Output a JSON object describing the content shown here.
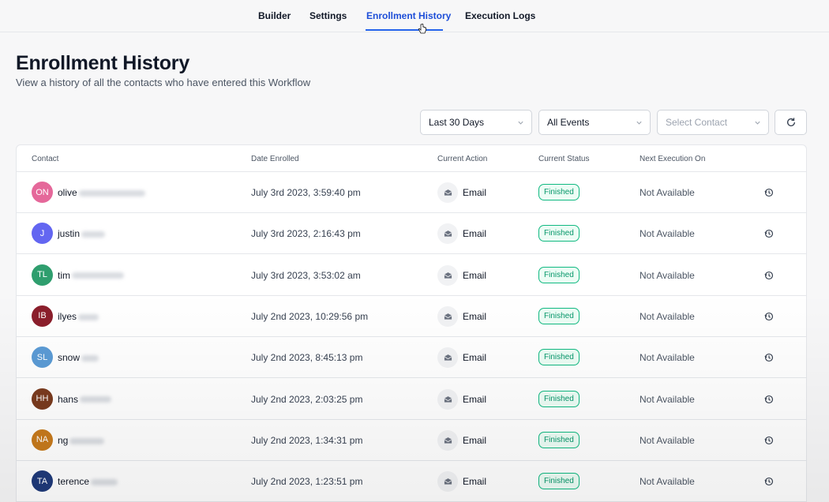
{
  "nav": {
    "tabs": [
      {
        "label": "Builder"
      },
      {
        "label": "Settings"
      },
      {
        "label": "Enrollment History",
        "active": true
      },
      {
        "label": "Execution Logs"
      }
    ]
  },
  "page": {
    "title": "Enrollment History",
    "subtitle": "View a history of all the contacts who have entered this Workflow"
  },
  "filters": {
    "date_range": "Last 30 Days",
    "events": "All Events",
    "contact_placeholder": "Select Contact",
    "refresh_icon": "refresh-icon"
  },
  "table": {
    "columns": [
      "Contact",
      "Date Enrolled",
      "Current Action",
      "Current Status",
      "Next Execution On"
    ],
    "rows": [
      {
        "initials": "ON",
        "avatar_color": "#e5689a",
        "name": "olive",
        "date": "July 3rd 2023, 3:59:40 pm",
        "action": "Email",
        "status": "Finished",
        "next": "Not Available"
      },
      {
        "initials": "J",
        "avatar_color": "#6366f1",
        "name": "justin",
        "date": "July 3rd 2023, 2:16:43 pm",
        "action": "Email",
        "status": "Finished",
        "next": "Not Available"
      },
      {
        "initials": "TL",
        "avatar_color": "#2f9e6e",
        "name": "tim",
        "date": "July 3rd 2023, 3:53:02 am",
        "action": "Email",
        "status": "Finished",
        "next": "Not Available"
      },
      {
        "initials": "IB",
        "avatar_color": "#8b1e2b",
        "name": "ilyes",
        "date": "July 2nd 2023, 10:29:56 pm",
        "action": "Email",
        "status": "Finished",
        "next": "Not Available"
      },
      {
        "initials": "SL",
        "avatar_color": "#5b9bd5",
        "name": "snow",
        "date": "July 2nd 2023, 8:45:13 pm",
        "action": "Email",
        "status": "Finished",
        "next": "Not Available"
      },
      {
        "initials": "HH",
        "avatar_color": "#7a3b1e",
        "name": "hans",
        "date": "July 2nd 2023, 2:03:25 pm",
        "action": "Email",
        "status": "Finished",
        "next": "Not Available"
      },
      {
        "initials": "NA",
        "avatar_color": "#c77a1c",
        "name": "ng",
        "date": "July 2nd 2023, 1:34:31 pm",
        "action": "Email",
        "status": "Finished",
        "next": "Not Available"
      },
      {
        "initials": "TA",
        "avatar_color": "#1f3a7a",
        "name": "terence",
        "date": "July 2nd 2023, 1:23:51 pm",
        "action": "Email",
        "status": "Finished",
        "next": "Not Available"
      }
    ]
  }
}
